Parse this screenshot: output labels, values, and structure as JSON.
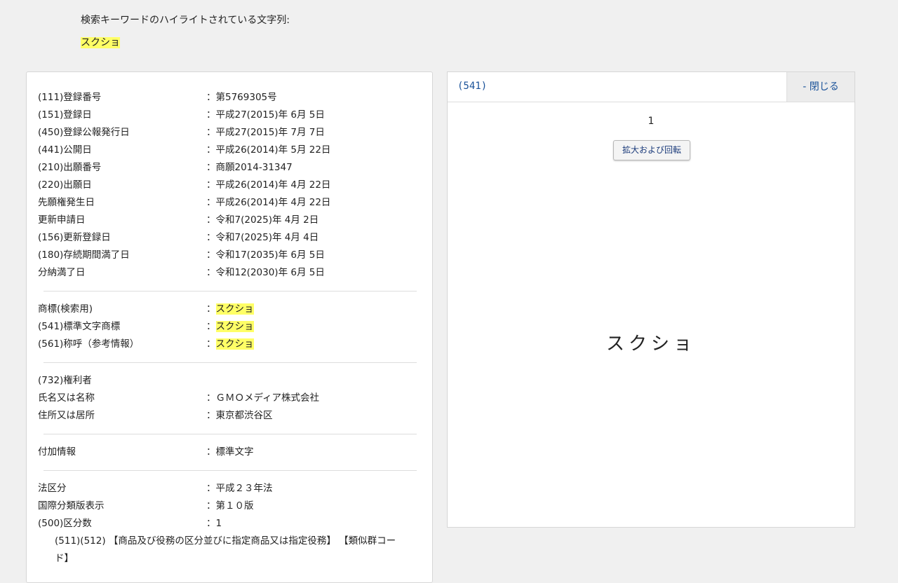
{
  "highlight": {
    "caption": "検索キーワードのハイライトされている文字列:",
    "word": "スクショ"
  },
  "basic": [
    {
      "label": "(111)登録番号",
      "value": "：第5769305号"
    },
    {
      "label": "(151)登録日",
      "value": "：平成27(2015)年 6月 5日"
    },
    {
      "label": "(450)登録公報発行日",
      "value": "：平成27(2015)年 7月 7日"
    },
    {
      "label": "(441)公開日",
      "value": "：平成26(2014)年 5月 22日"
    },
    {
      "label": "(210)出願番号",
      "value": "：商願2014-31347"
    },
    {
      "label": "(220)出願日",
      "value": "：平成26(2014)年 4月 22日"
    },
    {
      "label": "先願権発生日",
      "value": "：平成26(2014)年 4月 22日"
    },
    {
      "label": "更新申請日",
      "value": "：令和7(2025)年 4月 2日"
    },
    {
      "label": "(156)更新登録日",
      "value": "：令和7(2025)年 4月 4日"
    },
    {
      "label": "(180)存続期間満了日",
      "value": "：令和17(2035)年 6月 5日"
    },
    {
      "label": "分納満了日",
      "value": "：令和12(2030)年 6月 5日"
    }
  ],
  "mark": [
    {
      "label": "商標(検索用)",
      "prefix": "：",
      "value": "スクショ"
    },
    {
      "label": "(541)標準文字商標",
      "prefix": "：",
      "value": "スクショ"
    },
    {
      "label": "(561)称呼（参考情報）",
      "prefix": "：",
      "value": "スクショ"
    }
  ],
  "owner": {
    "heading": "(732)権利者",
    "rows": [
      {
        "label": "氏名又は名称",
        "value": "：ＧＭＯメディア株式会社"
      },
      {
        "label": "住所又は居所",
        "value": "：東京都渋谷区"
      }
    ]
  },
  "extra": {
    "label": "付加情報",
    "value": "：標準文字"
  },
  "classes": [
    {
      "label": "法区分",
      "value": "：平成２３年法"
    },
    {
      "label": "国際分類版表示",
      "value": "：第１０版"
    },
    {
      "label": "(500)区分数",
      "value": "：1"
    }
  ],
  "goods_heading": "(511)(512) 【商品及び役務の区分並びに指定商品又は指定役務】 【類似群コード】",
  "right_panel": {
    "title": "(541)",
    "close_label": "- 閉じる",
    "page_number": "1",
    "zoom_button": "拡大および回転",
    "mark_image_text": "スクショ"
  }
}
